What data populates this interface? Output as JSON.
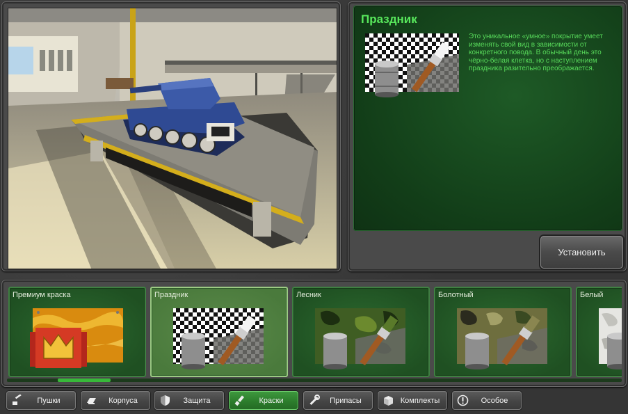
{
  "info": {
    "title": "Праздник",
    "description": "Это уникальное «умное» покрытие умеет изменять свой вид в зависимости от конкретного повода. В обычный день это чёрно-белая клетка, но с наступлением праздника разительно преображается.",
    "install_label": "Установить",
    "preview_icon": "checkered-paint-icon"
  },
  "items": [
    {
      "name": "Премиум краска",
      "icon": "premium-paint-icon",
      "selected": false
    },
    {
      "name": "Праздник",
      "icon": "checkered-paint-icon",
      "selected": true
    },
    {
      "name": "Лесник",
      "icon": "forest-camo-paint-icon",
      "selected": false
    },
    {
      "name": "Болотный",
      "icon": "swamp-camo-paint-icon",
      "selected": false
    },
    {
      "name": "Белый",
      "icon": "white-paint-icon",
      "selected": false
    }
  ],
  "tabs": [
    {
      "label": "Пушки",
      "icon": "turret-icon",
      "active": false
    },
    {
      "label": "Корпуса",
      "icon": "hull-icon",
      "active": false
    },
    {
      "label": "Защита",
      "icon": "shield-icon",
      "active": false
    },
    {
      "label": "Краски",
      "icon": "paint-brush-icon",
      "active": true
    },
    {
      "label": "Припасы",
      "icon": "wrench-icon",
      "active": false
    },
    {
      "label": "Комплекты",
      "icon": "box-icon",
      "active": false
    },
    {
      "label": "Особое",
      "icon": "exclamation-icon",
      "active": false
    }
  ],
  "scroll_position": 0.09,
  "colors": {
    "accent_green": "#58e85c",
    "panel_green": "#123d18",
    "active_tab": "#2c7d2c"
  }
}
